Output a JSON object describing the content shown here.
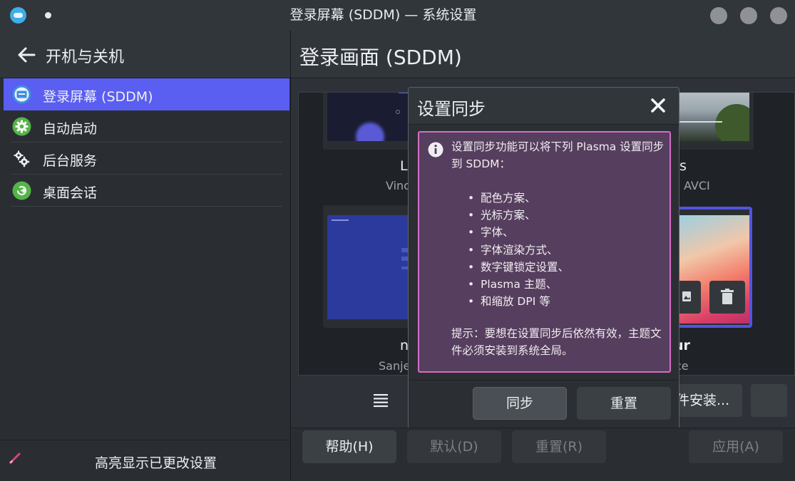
{
  "window": {
    "title": "登录屏幕 (SDDM) — 系统设置"
  },
  "sidebar": {
    "header_title": "开机与关机",
    "items": [
      {
        "label": "登录屏幕 (SDDM)",
        "icon": "login-screen-icon",
        "active": true
      },
      {
        "label": "自动启动",
        "icon": "autostart-gear-icon",
        "active": false
      },
      {
        "label": "后台服务",
        "icon": "background-services-icon",
        "active": false
      },
      {
        "label": "桌面会话",
        "icon": "desktop-session-icon",
        "active": false
      }
    ],
    "footer_label": "高亮显示已更改设置"
  },
  "main": {
    "title": "登录画面 (SDDM)",
    "cards": [
      {
        "name_fragment": "L",
        "author_fragment": "Vinc"
      },
      {
        "name_fragment": "s",
        "author_fragment": "AVCI"
      },
      {
        "name_fragment": "n",
        "author_fragment": "Sanje"
      },
      {
        "name_fragment": "ur",
        "author_fragment": "ce"
      }
    ],
    "install_button_fragment": "件安装...",
    "footer": {
      "help": "帮助(H)",
      "defaults": "默认(D)",
      "reset": "重置(R)",
      "apply": "应用(A)"
    }
  },
  "dialog": {
    "title": "设置同步",
    "intro": "设置同步功能可以将下列 Plasma 设置同步到 SDDM：",
    "items": [
      "配色方案、",
      "光标方案、",
      "字体、",
      "字体渲染方式、",
      "数字键锁定设置、",
      "Plasma 主题、",
      "和缩放 DPI 等"
    ],
    "note": "提示：要想在设置同步后依然有效，主题文件必须安装到系统全局。",
    "sync_button": "同步",
    "reset_button": "重置"
  },
  "colors": {
    "accent": "#5a5ef1",
    "message_background": "#563e5e",
    "message_border": "#d46ec6",
    "selected_card_border": "#5154e0"
  }
}
